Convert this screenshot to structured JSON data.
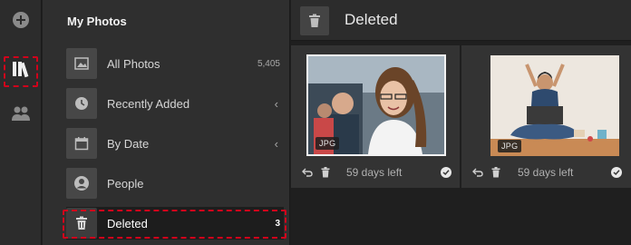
{
  "sidebar_rail": {
    "add_icon": "plus-circle-icon",
    "library_icon": "library-books-icon",
    "people_icon": "people-icon"
  },
  "panel": {
    "title": "My Photos",
    "items": [
      {
        "label": "All Photos",
        "count": "5,405",
        "icon": "image-icon"
      },
      {
        "label": "Recently Added",
        "icon": "clock-icon",
        "chevron": "‹"
      },
      {
        "label": "By Date",
        "icon": "calendar-icon",
        "chevron": "‹"
      },
      {
        "label": "People",
        "icon": "person-icon"
      },
      {
        "label": "Deleted",
        "count": "3",
        "icon": "trash-icon"
      }
    ]
  },
  "main": {
    "title": "Deleted",
    "photos": [
      {
        "badge": "JPG",
        "days_left": "59 days left"
      },
      {
        "badge": "JPG",
        "days_left": "59 days left"
      }
    ]
  },
  "colors": {
    "highlight_dash": "#d0021b",
    "background": "#1f1f1f",
    "panel": "#2f2f2f"
  }
}
